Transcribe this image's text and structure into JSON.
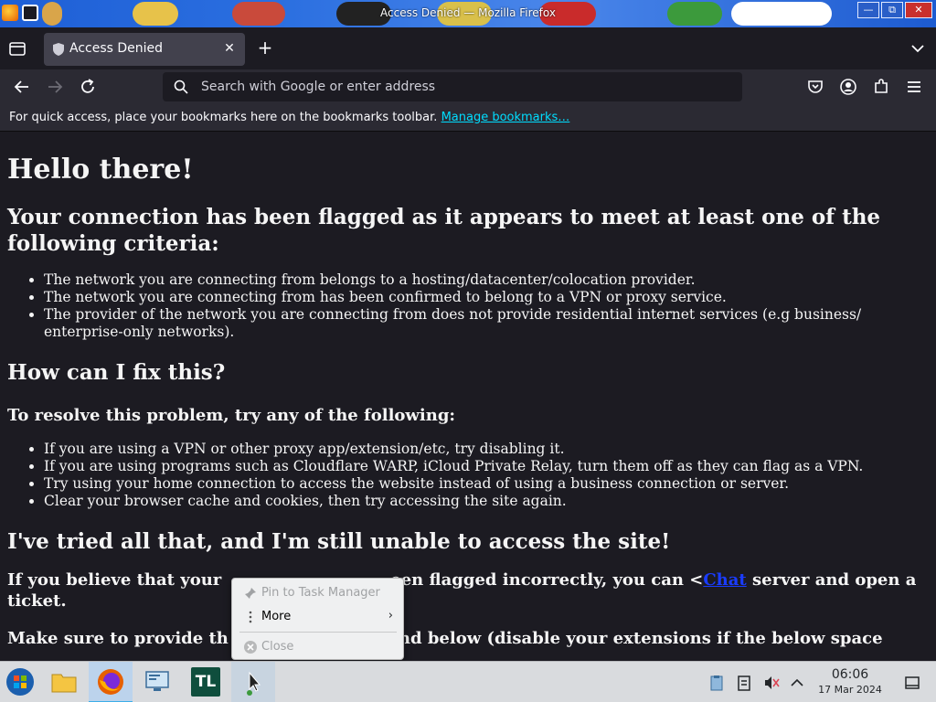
{
  "window": {
    "title": "Access Denied — Mozilla Firefox"
  },
  "tab": {
    "title": "Access Denied",
    "close": "✕"
  },
  "newtab": {
    "label": "+"
  },
  "urlbar": {
    "placeholder": "Search with Google or enter address",
    "value": ""
  },
  "bookmarks_bar": {
    "text": "For quick access, place your bookmarks here on the bookmarks toolbar. ",
    "link": "Manage bookmarks…"
  },
  "page": {
    "h1": "Hello there!",
    "h2_criteria": "Your connection has been flagged as it appears to meet at least one of the following criteria:",
    "criteria": [
      "The network you are connecting from belongs to a hosting/datacenter/colocation provider.",
      "The network you are connecting from has been confirmed to belong to a VPN or proxy service.",
      "The provider of the network you are connecting from does not provide residential internet services (e.g business/ enterprise-only networks)."
    ],
    "h2_fix": "How can I fix this?",
    "h3_resolve": "To resolve this problem, try any of the following:",
    "fixes": [
      "If you are using a VPN or other proxy app/extension/etc, try disabling it.",
      "If you are using programs such as Cloudflare WARP, iCloud Private Relay, turn them off as they can flag as a VPN.",
      "Try using your home connection to access the website instead of using a business connection or server.",
      "Clear your browser cache and cookies, then try accessing the site again."
    ],
    "h2_tried": "I've tried all that, and I'm still unable to access the site!",
    "p_believe_1": "If you believe that your",
    "p_believe_2": "een flagged incorrectly, you can <",
    "p_believe_link": "Chat",
    "p_believe_3": " server and open a ticket.",
    "p_provide_1": "Make sure to provide th",
    "p_provide_2": "nd below (disable your extensions if the below space"
  },
  "context_menu": {
    "items": [
      {
        "label": "Pin to Task Manager",
        "disabled": true
      },
      {
        "label": "More",
        "disabled": false,
        "arrow": "›"
      },
      {
        "label": "Close",
        "disabled": true
      }
    ]
  },
  "taskbar": {
    "apps": [
      "Start",
      "File Manager",
      "Firefox",
      "System Settings",
      "TL",
      "Unknown app"
    ],
    "tl_label": "TL",
    "clock": {
      "time": "06:06",
      "date": "17 Mar 2024"
    }
  },
  "colors": {
    "content_bg": "#1c1b22",
    "toolbar_bg": "#2b2a33",
    "tab_active_bg": "#42414d",
    "link_bookmarks": "#00ddff",
    "link_page": "#1a3cff",
    "titlebar": "#1e5fd6"
  },
  "icons": {
    "tab": "shield-icon",
    "back": "arrow-left-icon",
    "forward": "arrow-right-icon",
    "reload": "reload-icon",
    "search": "search-icon",
    "pocket": "pocket-icon",
    "account": "account-icon",
    "extensions": "puzzle-icon",
    "menu": "hamburger-icon"
  }
}
